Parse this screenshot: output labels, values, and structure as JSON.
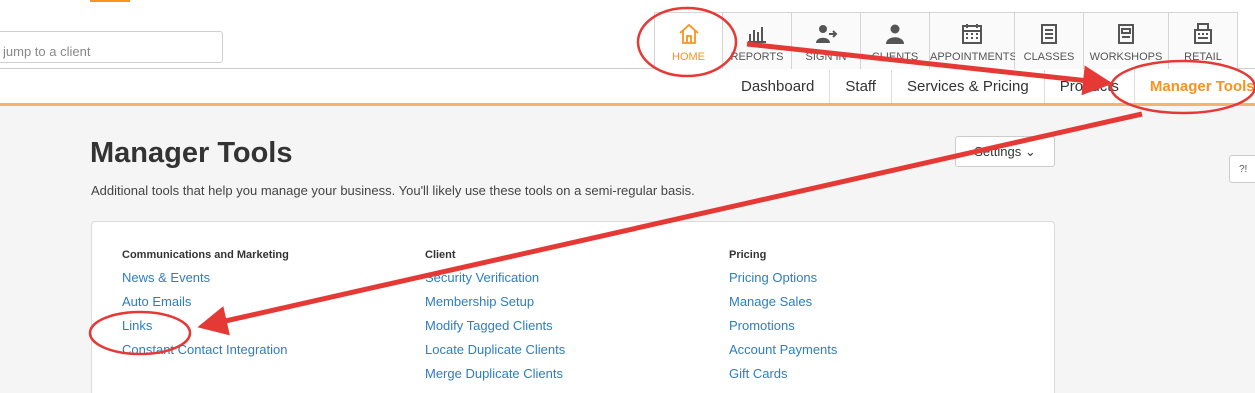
{
  "search": {
    "placeholder": "jump to a client"
  },
  "nav": {
    "tabs": [
      {
        "label": "HOME",
        "icon": "home-icon"
      },
      {
        "label": "REPORTS",
        "icon": "bar-chart-icon"
      },
      {
        "label": "SIGN IN",
        "icon": "sign-in-icon"
      },
      {
        "label": "CLIENTS",
        "icon": "person-icon"
      },
      {
        "label": "APPOINTMENTS",
        "icon": "calendar-icon"
      },
      {
        "label": "CLASSES",
        "icon": "class-list-icon"
      },
      {
        "label": "WORKSHOPS",
        "icon": "workshop-icon"
      },
      {
        "label": "RETAIL",
        "icon": "register-icon"
      }
    ],
    "subnav": [
      "Dashboard",
      "Staff",
      "Services & Pricing",
      "Products",
      "Manager Tools"
    ]
  },
  "page": {
    "title": "Manager Tools",
    "description": "Additional tools that help you manage your business. You'll likely use these tools on a semi-regular basis.",
    "settings_label": "Settings",
    "help_label": "?!"
  },
  "sections": [
    {
      "heading": "Communications and Marketing",
      "links": [
        "News & Events",
        "Auto Emails",
        "Links",
        "Constant Contact Integration"
      ]
    },
    {
      "heading": "Client",
      "links": [
        "Security Verification",
        "Membership Setup",
        "Modify Tagged Clients",
        "Locate Duplicate Clients",
        "Merge Duplicate Clients"
      ]
    },
    {
      "heading": "Pricing",
      "links": [
        "Pricing Options",
        "Manage Sales",
        "Promotions",
        "Account Payments",
        "Gift Cards"
      ]
    }
  ],
  "colors": {
    "accent": "#f7941d",
    "link": "#2a7fc1",
    "annotation": "#e53935"
  }
}
